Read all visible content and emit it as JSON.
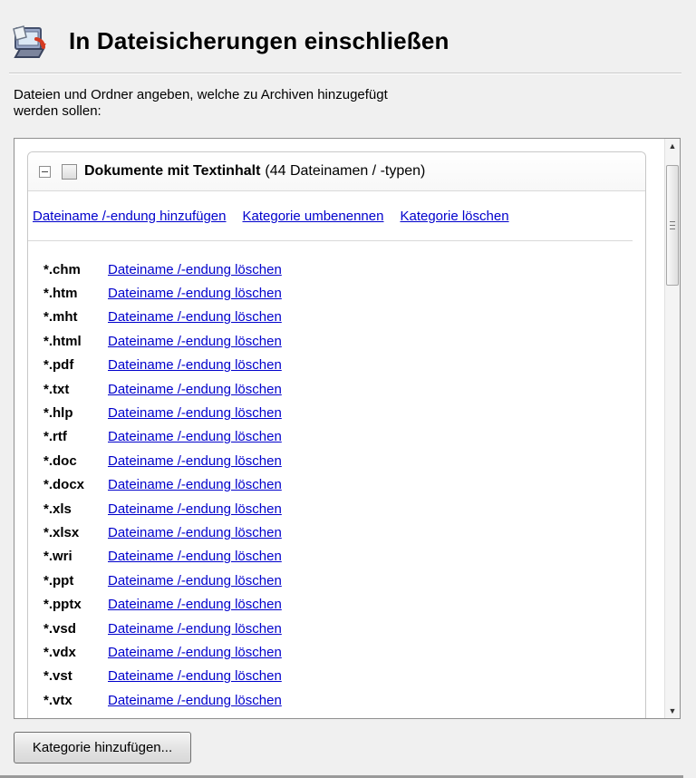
{
  "header": {
    "title": "In Dateisicherungen einschließen",
    "icon": "backup-folder-icon"
  },
  "description": {
    "line1": "Dateien und Ordner angeben, welche zu Archiven hinzugefügt",
    "line2": "werden sollen:"
  },
  "category": {
    "name": "Dokumente mit Textinhalt",
    "count": "(44 Dateinamen / -typen)",
    "checked": false,
    "collapsed": false,
    "actions": [
      {
        "label": "Dateiname /-endung hinzufügen"
      },
      {
        "label": "Kategorie umbenennen"
      },
      {
        "label": "Kategorie löschen"
      }
    ],
    "extensions": [
      {
        "name": "*.chm",
        "action": "Dateiname /-endung löschen"
      },
      {
        "name": "*.htm",
        "action": "Dateiname /-endung löschen"
      },
      {
        "name": "*.mht",
        "action": "Dateiname /-endung löschen"
      },
      {
        "name": "*.html",
        "action": "Dateiname /-endung löschen"
      },
      {
        "name": "*.pdf",
        "action": "Dateiname /-endung löschen"
      },
      {
        "name": "*.txt",
        "action": "Dateiname /-endung löschen"
      },
      {
        "name": "*.hlp",
        "action": "Dateiname /-endung löschen"
      },
      {
        "name": "*.rtf",
        "action": "Dateiname /-endung löschen"
      },
      {
        "name": "*.doc",
        "action": "Dateiname /-endung löschen"
      },
      {
        "name": "*.docx",
        "action": "Dateiname /-endung löschen"
      },
      {
        "name": "*.xls",
        "action": "Dateiname /-endung löschen"
      },
      {
        "name": "*.xlsx",
        "action": "Dateiname /-endung löschen"
      },
      {
        "name": "*.wri",
        "action": "Dateiname /-endung löschen"
      },
      {
        "name": "*.ppt",
        "action": "Dateiname /-endung löschen"
      },
      {
        "name": "*.pptx",
        "action": "Dateiname /-endung löschen"
      },
      {
        "name": "*.vsd",
        "action": "Dateiname /-endung löschen"
      },
      {
        "name": "*.vdx",
        "action": "Dateiname /-endung löschen"
      },
      {
        "name": "*.vst",
        "action": "Dateiname /-endung löschen"
      },
      {
        "name": "*.vtx",
        "action": "Dateiname /-endung löschen"
      }
    ]
  },
  "footer": {
    "add_category_button": "Kategorie hinzufügen..."
  },
  "colors": {
    "link": "#0000cc",
    "window_background": "#f0f0f0",
    "list_background": "#ffffff"
  }
}
